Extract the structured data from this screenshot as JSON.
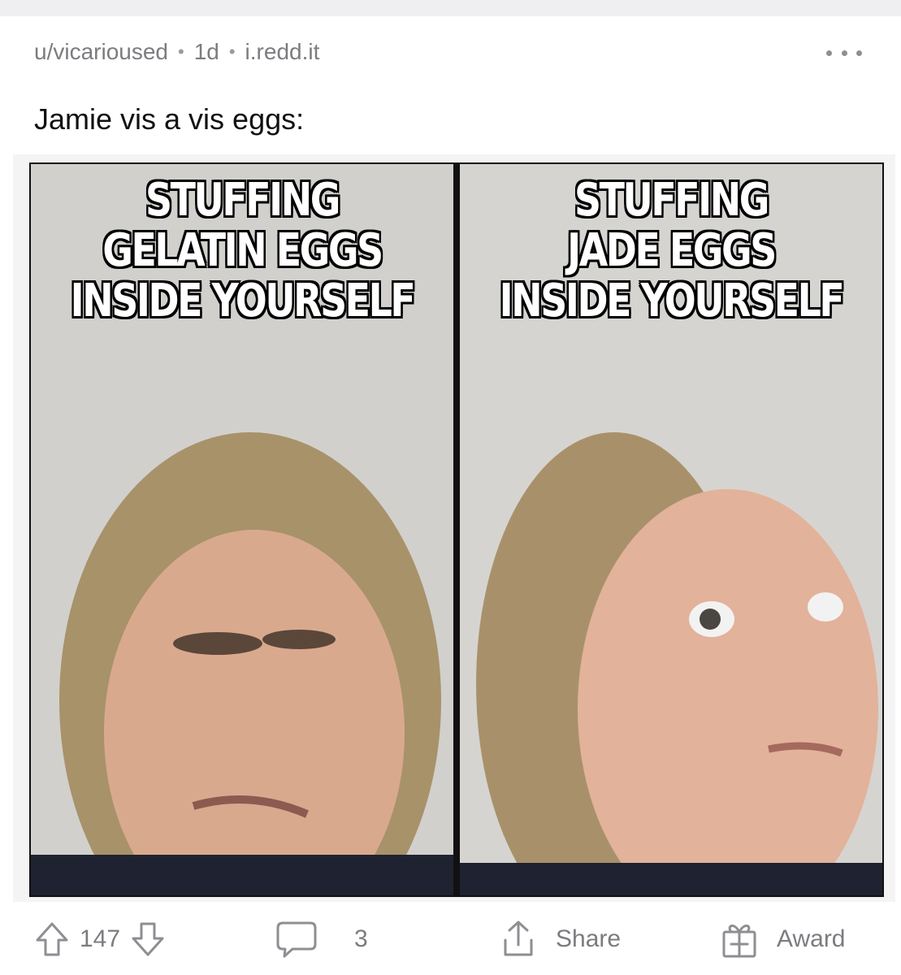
{
  "post": {
    "author": "u/vicarioused",
    "age": "1d",
    "domain": "i.redd.it",
    "title": "Jamie vis a vis eggs:",
    "more_icon": "more-horizontal-icon"
  },
  "meme": {
    "left_caption": [
      "STUFFING",
      "GELATIN EGGS",
      "INSIDE YOURSELF"
    ],
    "right_caption": [
      "STUFFING",
      "JADE EGGS",
      "INSIDE YOURSELF"
    ]
  },
  "actions": {
    "upvote_icon": "arrow-up-icon",
    "score": "147",
    "downvote_icon": "arrow-down-icon",
    "comment_icon": "comment-bubble-icon",
    "comments": "3",
    "share_icon": "share-upload-icon",
    "share_label": "Share",
    "award_icon": "gift-award-icon",
    "award_label": "Award"
  },
  "colors": {
    "meta_text": "#7c7c80",
    "title_text": "#111111",
    "action_text": "#7c7c80",
    "top_strip": "#efeff1"
  }
}
